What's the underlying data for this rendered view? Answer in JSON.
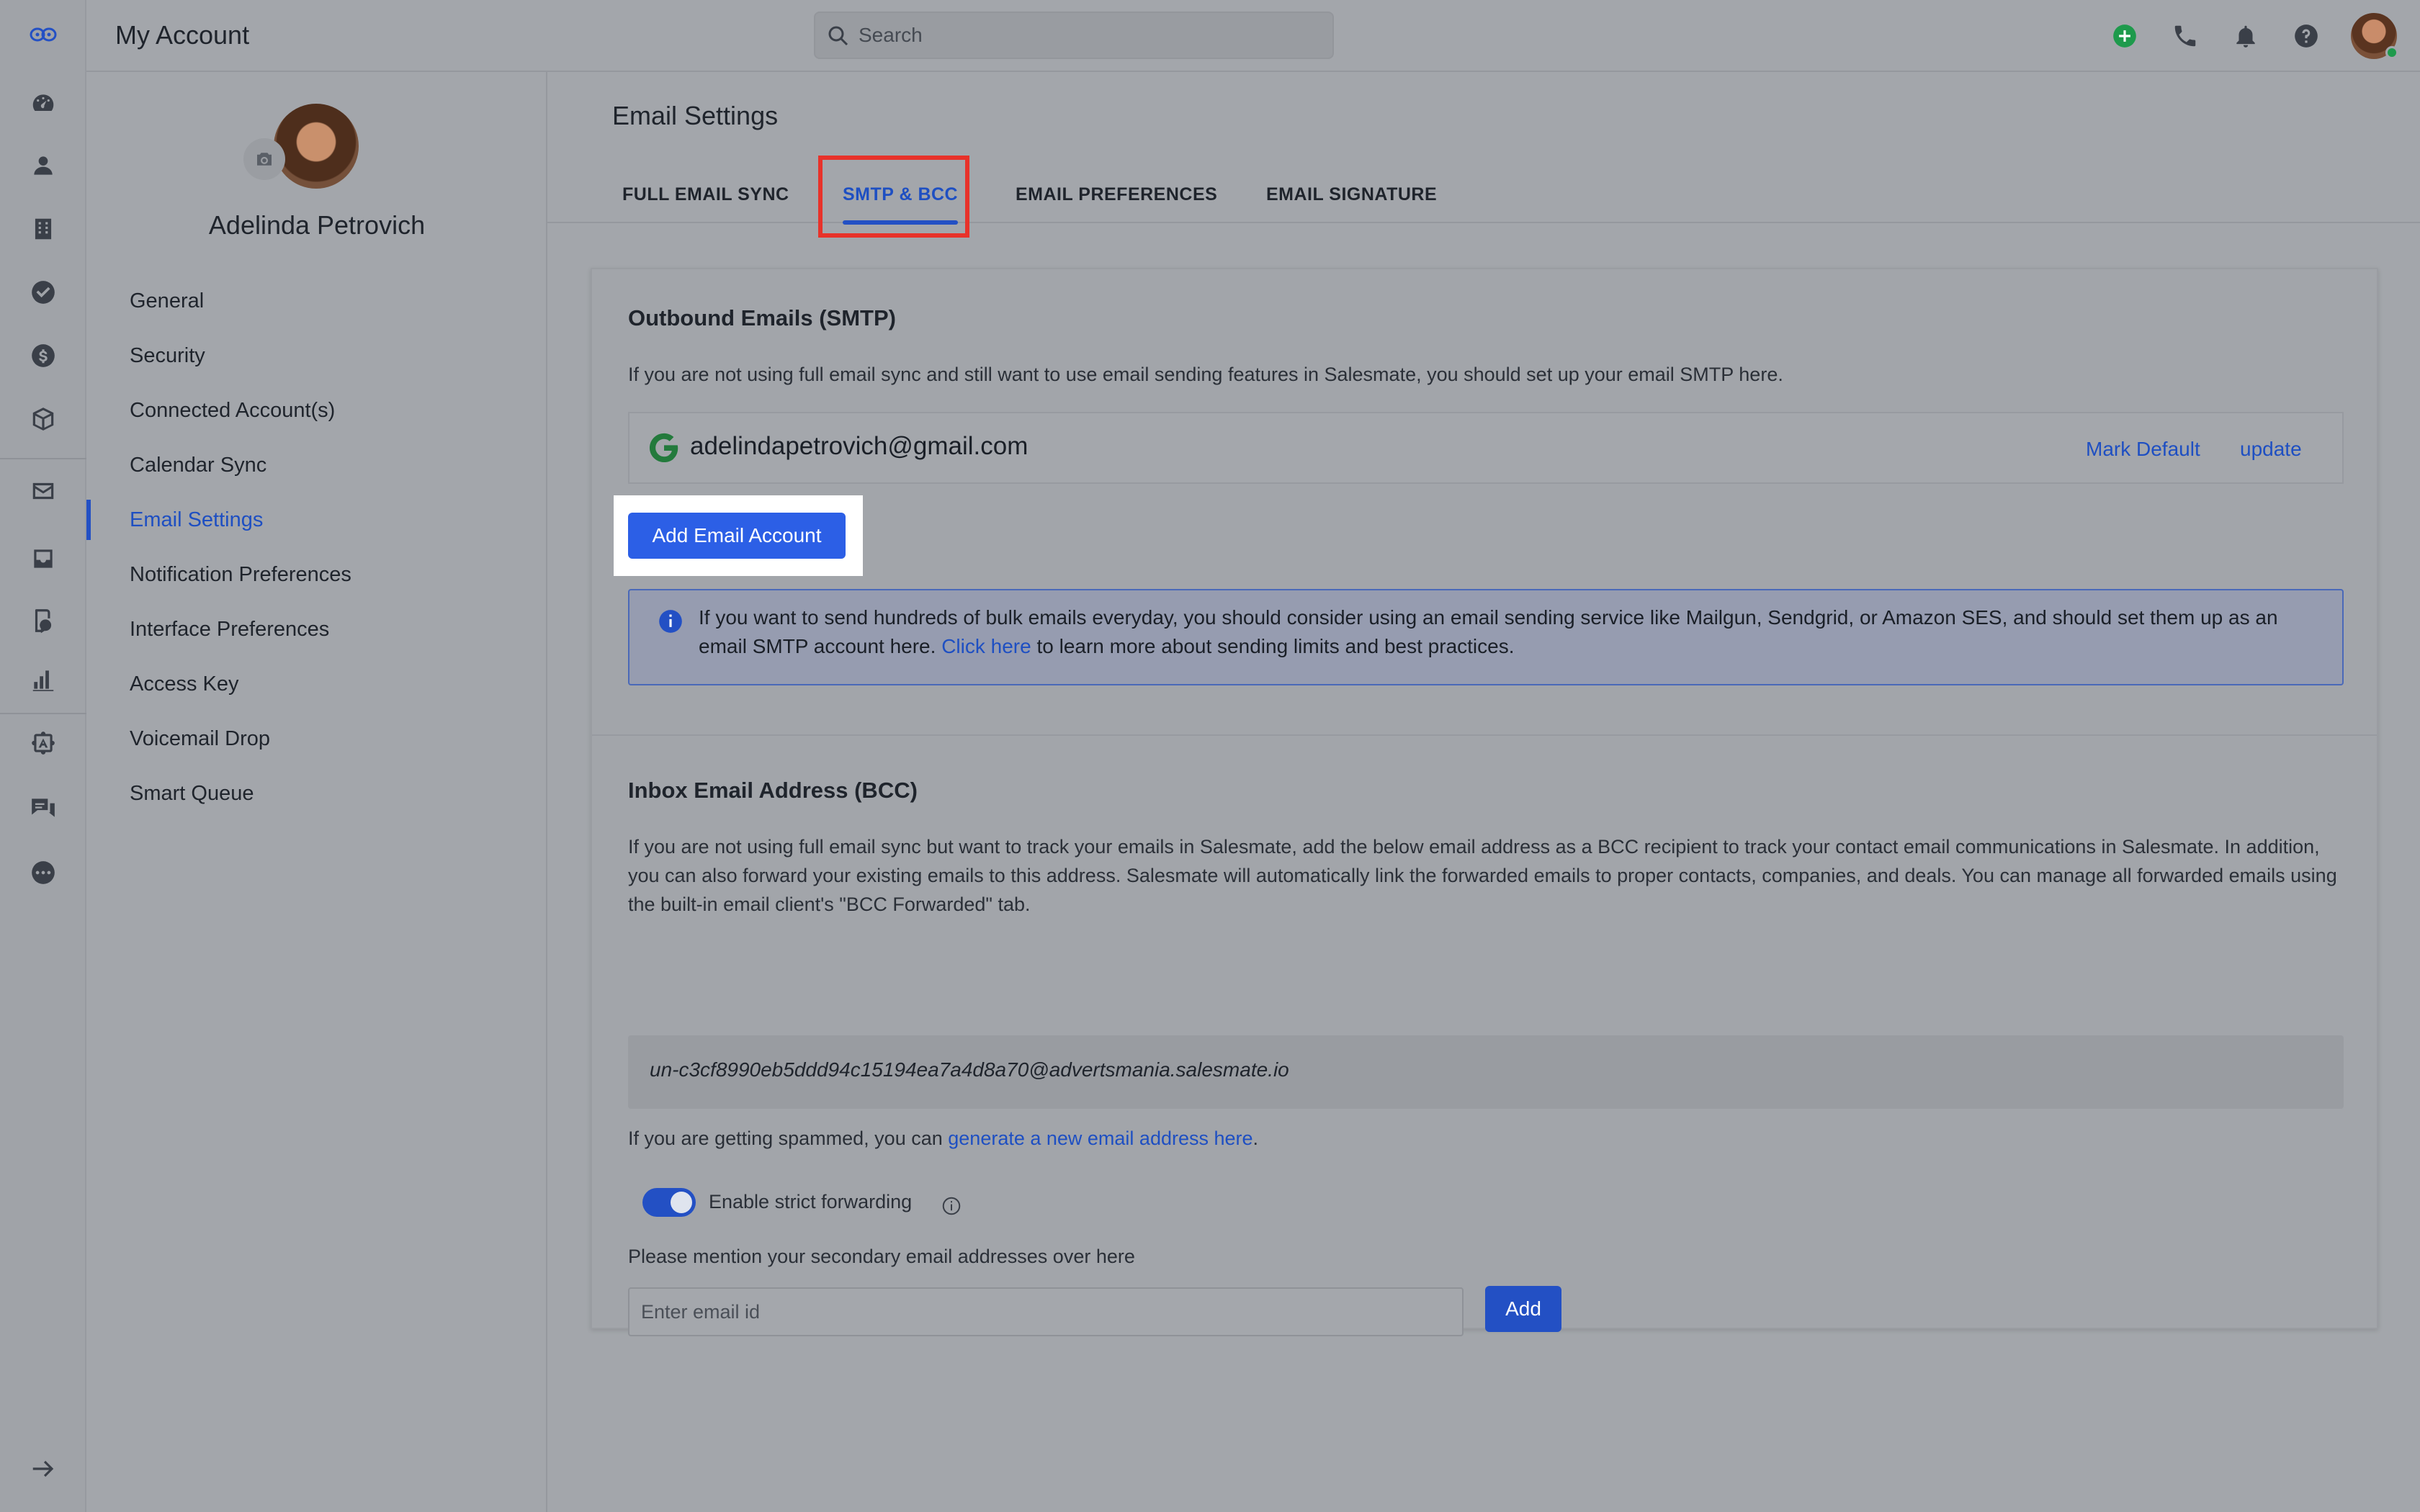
{
  "topbar": {
    "title": "My Account",
    "search_placeholder": "Search"
  },
  "profile": {
    "name": "Adelinda Petrovich"
  },
  "account_menu": [
    {
      "label": "General"
    },
    {
      "label": "Security"
    },
    {
      "label": "Connected Account(s)"
    },
    {
      "label": "Calendar Sync"
    },
    {
      "label": "Email Settings",
      "active": true
    },
    {
      "label": "Notification Preferences"
    },
    {
      "label": "Interface Preferences"
    },
    {
      "label": "Access Key"
    },
    {
      "label": "Voicemail Drop"
    },
    {
      "label": "Smart Queue"
    }
  ],
  "main": {
    "title": "Email Settings",
    "tabs": [
      {
        "label": "FULL EMAIL SYNC"
      },
      {
        "label": "SMTP & BCC",
        "active": true
      },
      {
        "label": "EMAIL PREFERENCES"
      },
      {
        "label": "EMAIL SIGNATURE"
      }
    ]
  },
  "smtp": {
    "title": "Outbound Emails (SMTP)",
    "description": "If you are not using full email sync and still want to use email sending features in Salesmate, you should set up your email SMTP here.",
    "account_email": "adelindapetrovich@gmail.com",
    "mark_default_label": "Mark Default",
    "update_label": "update",
    "add_button_label": "Add Email Account",
    "info_text_before": "If you want to send hundreds of bulk emails everyday, you should consider using an email sending service like Mailgun, Sendgrid, or Amazon SES, and should set them up as an email SMTP account here.",
    "info_link": "Click here",
    "info_text_after": "to learn more about sending limits and best practices."
  },
  "bcc": {
    "title": "Inbox Email Address (BCC)",
    "description": "If you are not using full email sync but want to track your emails in Salesmate, add the below email address as a BCC recipient to track your contact email communications in Salesmate. In addition, you can also forward your existing emails to this address. Salesmate will automatically link the forwarded emails to proper contacts, companies, and deals. You can manage all forwarded emails using the built-in email client's \"BCC Forwarded\" tab.",
    "address": "un-c3cf8990eb5ddd94c15194ea7a4d8a70@advertsmania.salesmate.io",
    "spam_text": "If you are getting spammed, you can",
    "spam_link": "generate a new email address here",
    "spam_end": ".",
    "strict_forwarding_label": "Enable strict forwarding",
    "strict_forwarding_on": true,
    "secondary_label": "Please mention your secondary email addresses over here",
    "secondary_placeholder": "Enter email id",
    "add_label": "Add"
  },
  "colors": {
    "accent": "#2350c4",
    "highlight_box": "#e8322a",
    "primary_button": "#2c5fe6"
  }
}
